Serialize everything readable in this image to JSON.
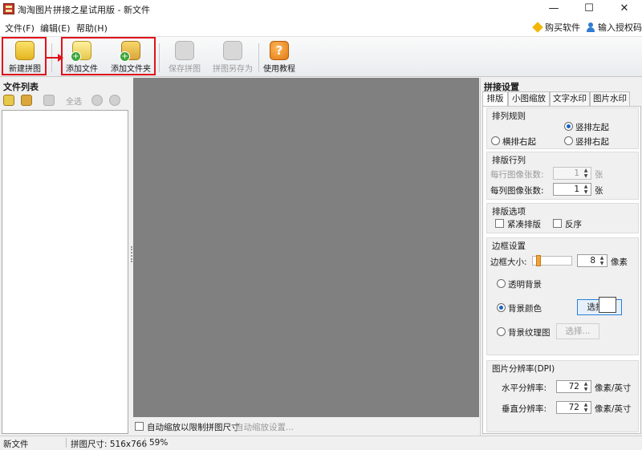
{
  "window": {
    "title": "淘淘图片拼接之星试用版 - 新文件",
    "controls": {
      "minimize": "—",
      "maximize": "☐",
      "close": "✕"
    }
  },
  "menu": {
    "items": [
      "文件(F)",
      "编辑(E)",
      "帮助(H)"
    ],
    "buy": "购买软件",
    "license": "输入授权码"
  },
  "toolbar": {
    "new_collage": "新建拼图",
    "add_file": "添加文件",
    "add_folder": "添加文件夹",
    "save_collage": "保存拼图",
    "save_as": "拼图另存为",
    "tutorial": "使用教程",
    "highlight_color": "#e0121a"
  },
  "file_panel": {
    "title": "文件列表",
    "select_all": "全选"
  },
  "canvas_options": {
    "auto_zoom_label": "自动缩放以限制拼图尺寸",
    "auto_zoom_checked": false,
    "auto_zoom_settings": "自动缩放设置..."
  },
  "settings": {
    "title": "拼接设置",
    "tabs": [
      "排版",
      "小图缩放",
      "文字水印",
      "图片水印"
    ],
    "active_tab": 0,
    "arrange_rule": {
      "title": "排列规则",
      "options": [
        "竖排左起",
        "横排右起",
        "竖排右起"
      ],
      "selected": "竖排左起"
    },
    "rows_cols": {
      "title": "排版行列",
      "per_row_label": "每行图像张数:",
      "per_row_value": "1",
      "per_col_label": "每列图像张数:",
      "per_col_value": "1",
      "unit": "张"
    },
    "layout_options": {
      "title": "排版选项",
      "compact": "紧凑排版",
      "compact_checked": false,
      "reverse": "反序",
      "reverse_checked": false
    },
    "border": {
      "title": "边框设置",
      "size_label": "边框大小:",
      "size_value": "8",
      "size_unit": "像素",
      "slider_level": 8,
      "bg_options": [
        "透明背景",
        "背景颜色",
        "背景纹理图"
      ],
      "bg_selected": "背景颜色",
      "choose": "选择...",
      "choose_texture": "选择...",
      "bg_color": "#ffffff"
    },
    "dpi": {
      "title": "图片分辨率(DPI)",
      "h_label": "水平分辨率:",
      "h_value": "72",
      "v_label": "垂直分辨率:",
      "v_value": "72",
      "unit": "像素/英寸"
    }
  },
  "status": {
    "file": "新文件",
    "size": "拼图尺寸: 516x766",
    "zoom": "59%"
  }
}
